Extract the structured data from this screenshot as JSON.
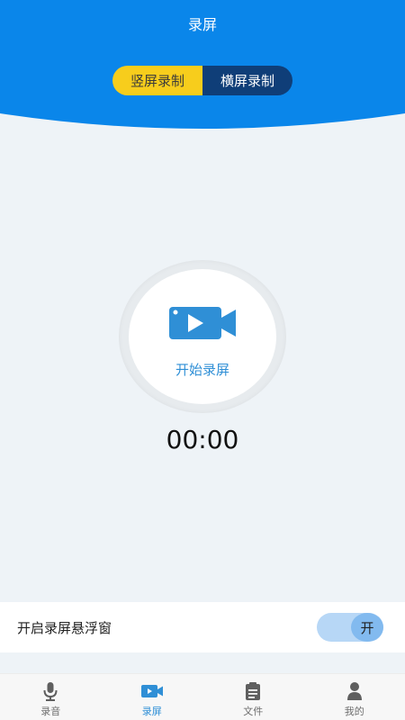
{
  "header": {
    "title": "录屏",
    "segments": [
      {
        "label": "竖屏录制",
        "active": true
      },
      {
        "label": "横屏录制",
        "active": false
      }
    ],
    "color": "#0a86ea"
  },
  "recorder": {
    "button_label": "开始录屏",
    "timer": "00:00",
    "icon": "video-camera-icon",
    "accent": "#2f8fd6"
  },
  "floating_window": {
    "label": "开启录屏悬浮窗",
    "toggle_text": "开"
  },
  "tabbar": {
    "items": [
      {
        "label": "录音",
        "icon": "microphone-icon",
        "active": false
      },
      {
        "label": "录屏",
        "icon": "video-camera-icon",
        "active": true
      },
      {
        "label": "文件",
        "icon": "clipboard-icon",
        "active": false
      },
      {
        "label": "我的",
        "icon": "user-icon",
        "active": false
      }
    ]
  }
}
